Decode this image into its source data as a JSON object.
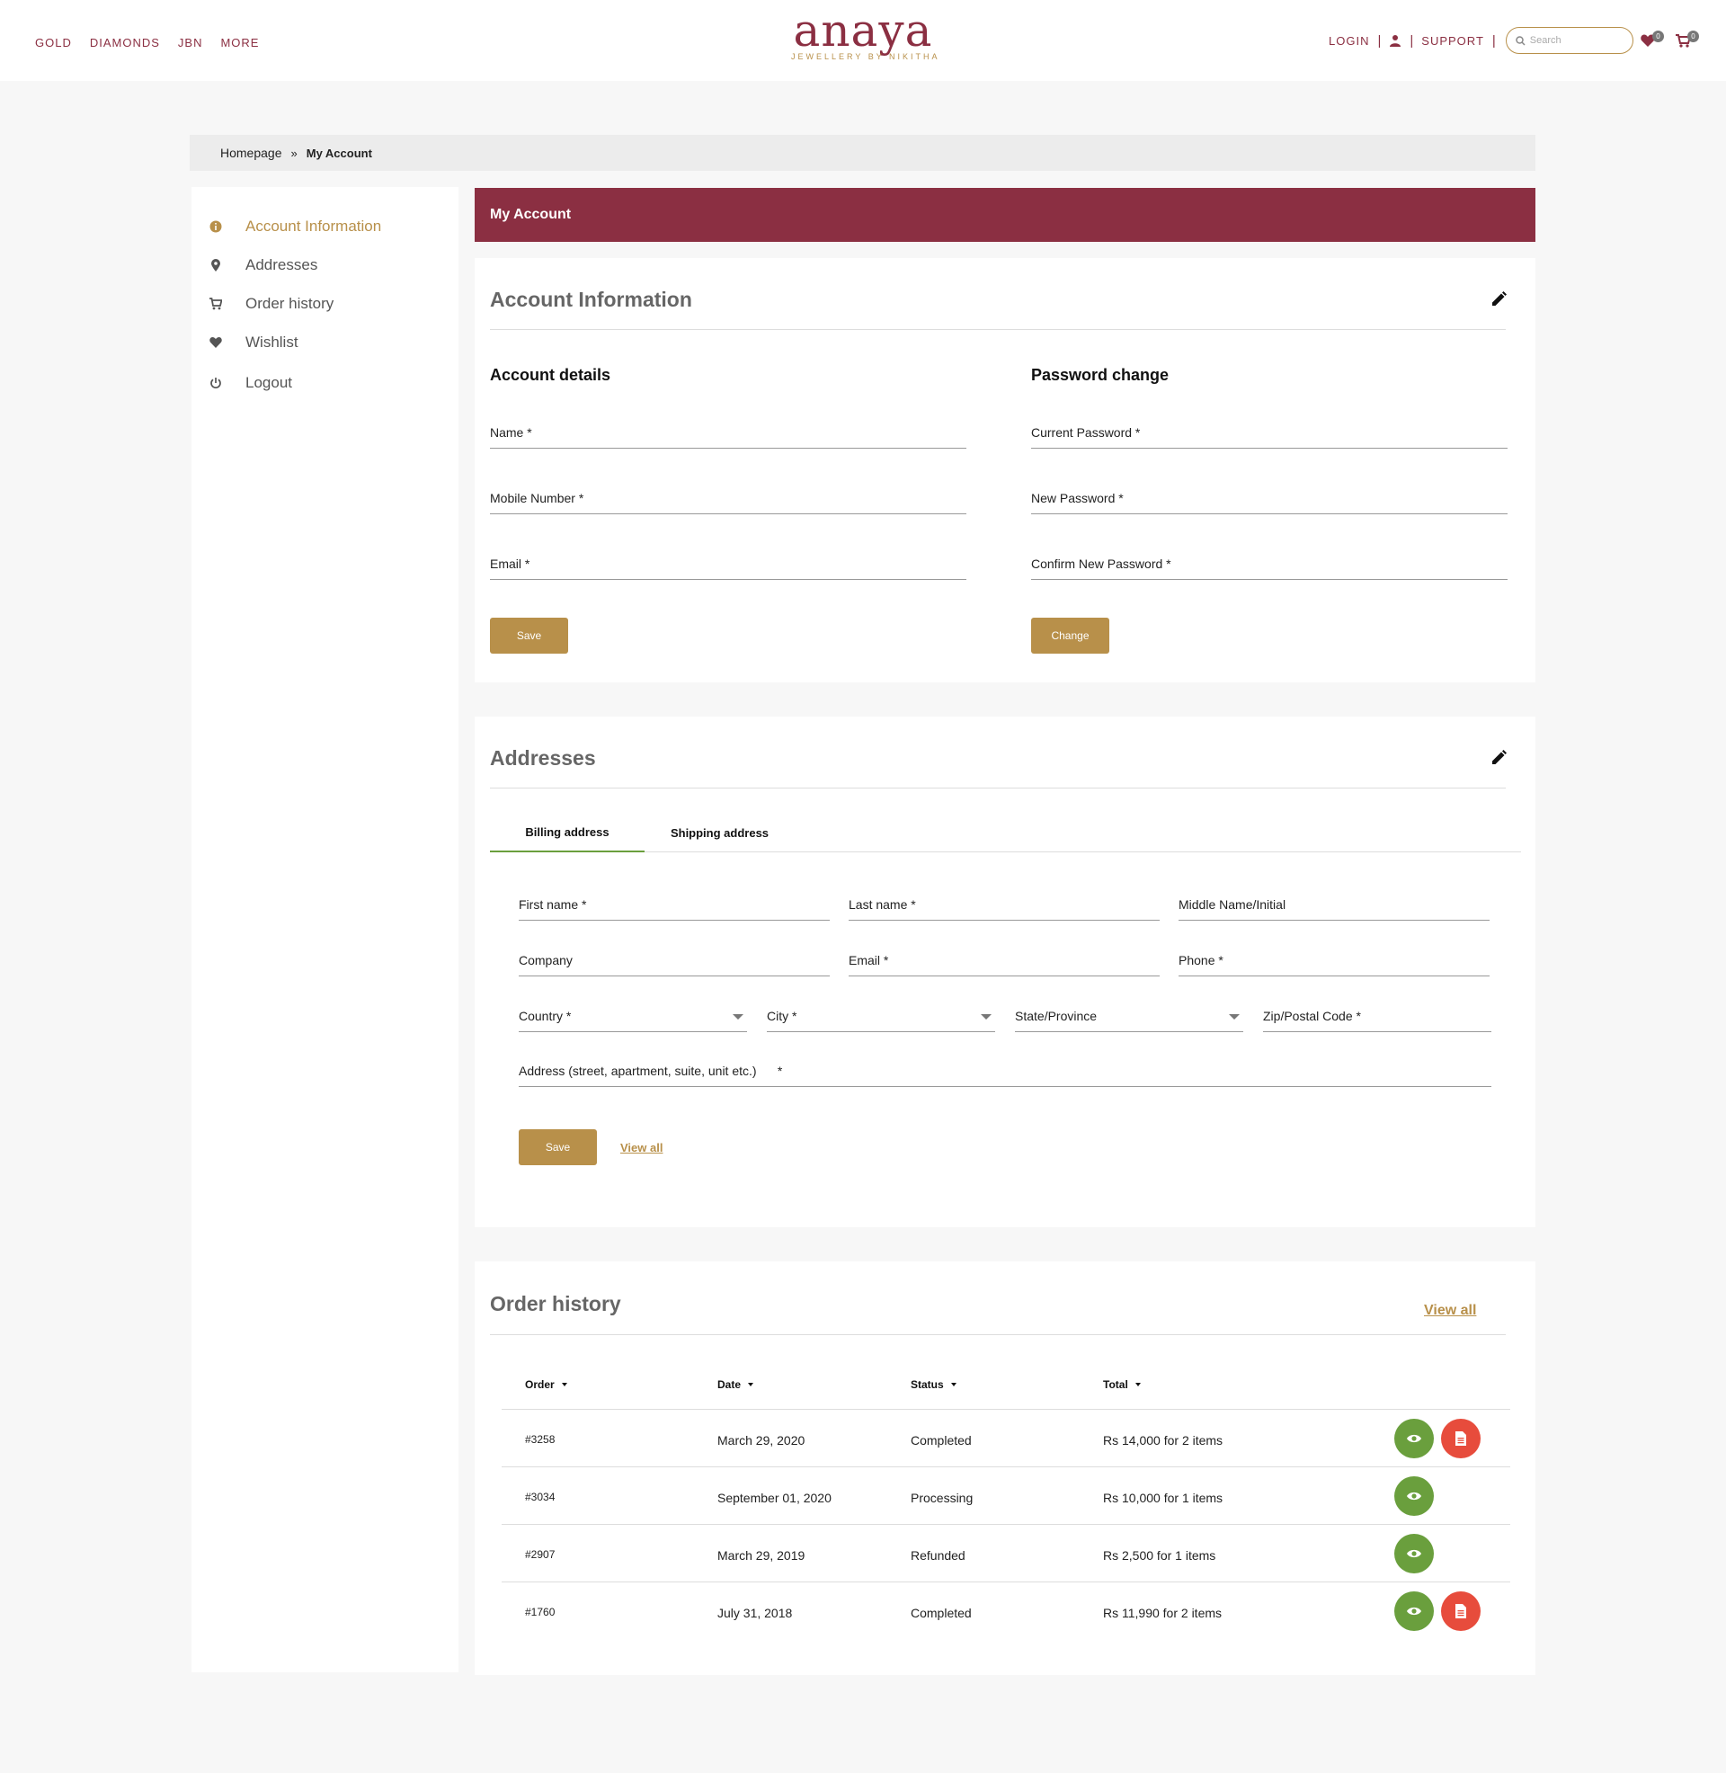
{
  "header": {
    "nav_left": [
      "GOLD",
      "DIAMONDS",
      "JBN",
      "MORE"
    ],
    "logo_word": "anaya",
    "logo_sub": "JEWELLERY BY NIKITHA",
    "login": "LOGIN",
    "support": "SUPPORT",
    "search_placeholder": "Search",
    "wishlist_count": "0",
    "cart_count": "0"
  },
  "breadcrumb": {
    "home": "Homepage",
    "sep": "»",
    "current": "My Account"
  },
  "sidebar": {
    "items": [
      {
        "label": "Account Information",
        "icon": "info-icon",
        "active": true
      },
      {
        "label": "Addresses",
        "icon": "map-pin-icon"
      },
      {
        "label": "Order history",
        "icon": "cart-icon"
      },
      {
        "label": "Wishlist",
        "icon": "heart-icon"
      },
      {
        "label": "Logout",
        "icon": "power-icon"
      }
    ]
  },
  "page_title": "My Account",
  "account": {
    "title": "Account Information",
    "details_title": "Account details",
    "name_label": "Name *",
    "mobile_label": "Mobile Number  *",
    "email_label": "Email *",
    "save_label": "Save",
    "password_title": "Password change",
    "current_pw_label": "Current Password *",
    "new_pw_label": "New Password   *",
    "confirm_pw_label": "Confirm New Password    *",
    "change_label": "Change"
  },
  "addresses": {
    "title": "Addresses",
    "tabs": [
      "Billing address",
      "Shipping address"
    ],
    "first_name": "First name *",
    "last_name": "Last name   *",
    "middle_name": "Middle Name/Initial",
    "company": "Company",
    "email": "Email *",
    "phone": "Phone *",
    "country": "Country   *",
    "city": "City *",
    "state": "State/Province",
    "zip": "Zip/Postal Code *",
    "address": "Address (street, apartment, suite, unit etc.)      *",
    "save_label": "Save",
    "view_all": "View all"
  },
  "orders": {
    "title": "Order history",
    "view_all": "View all",
    "columns": [
      "Order",
      "Date",
      "Status",
      "Total"
    ],
    "rows": [
      {
        "order": "#3258",
        "date": "March 29, 2020",
        "status": "Completed",
        "total": "Rs 14,000 for 2 items",
        "invoice": true
      },
      {
        "order": "#3034",
        "date": "September 01, 2020",
        "status": "Processing",
        "total": "Rs 10,000 for 1 items",
        "invoice": false
      },
      {
        "order": "#2907",
        "date": "March 29, 2019",
        "status": "Refunded",
        "total": "Rs 2,500 for 1 items",
        "invoice": false
      },
      {
        "order": "#1760",
        "date": "July 31, 2018",
        "status": "Completed",
        "total": "Rs 11,990 for 2 items",
        "invoice": true
      }
    ]
  },
  "colors": {
    "brand": "#8b2f42",
    "gold": "#b8904a",
    "green": "#6a9f3d",
    "red": "#e74c3c"
  }
}
